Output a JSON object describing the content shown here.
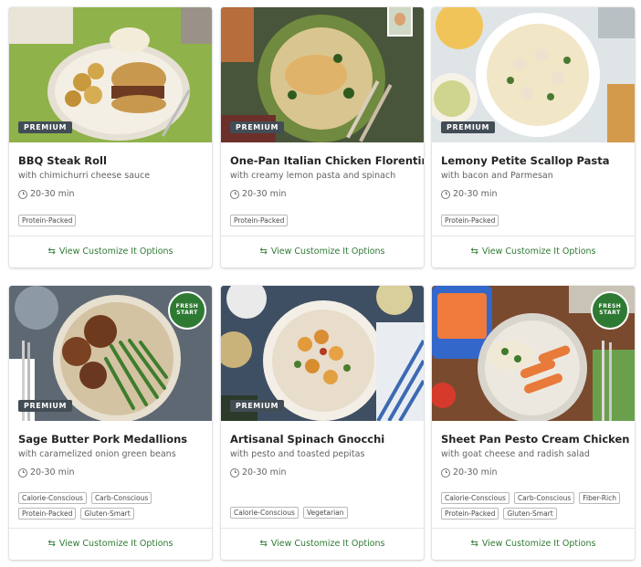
{
  "customize_label": "View Customize It Options",
  "icons": {
    "clock": "clock-icon",
    "swap": "swap-arrows-icon"
  },
  "accent_color": "#2f7a33",
  "recipes": [
    {
      "title": "BBQ Steak Roll",
      "subtitle": "with chimichurri cheese sauce",
      "time": "20-30 min",
      "badge": "PREMIUM",
      "tags": [
        "Protein-Packed"
      ]
    },
    {
      "title": "One-Pan Italian Chicken Florentine",
      "subtitle": "with creamy lemon pasta and spinach",
      "time": "20-30 min",
      "badge": "PREMIUM",
      "tags": [
        "Protein-Packed"
      ]
    },
    {
      "title": "Lemony Petite Scallop Pasta",
      "subtitle": "with bacon and Parmesan",
      "time": "20-30 min",
      "badge": "PREMIUM",
      "tags": [
        "Protein-Packed"
      ]
    },
    {
      "title": "Sage Butter Pork Medallions",
      "subtitle": "with caramelized onion green beans",
      "time": "20-30 min",
      "badge": "PREMIUM",
      "fresh_start": "FRESH START",
      "tags": [
        "Calorie-Conscious",
        "Carb-Conscious",
        "Protein-Packed",
        "Gluten-Smart"
      ]
    },
    {
      "title": "Artisanal Spinach Gnocchi",
      "subtitle": "with pesto and toasted pepitas",
      "time": "20-30 min",
      "badge": "PREMIUM",
      "tags": [
        "Calorie-Conscious",
        "Vegetarian"
      ]
    },
    {
      "title": "Sheet Pan Pesto Cream Chicken",
      "subtitle": "with goat cheese and radish salad",
      "time": "20-30 min",
      "fresh_start": "FRESH START",
      "tags": [
        "Calorie-Conscious",
        "Carb-Conscious",
        "Fiber-Rich",
        "Protein-Packed",
        "Gluten-Smart"
      ]
    }
  ]
}
